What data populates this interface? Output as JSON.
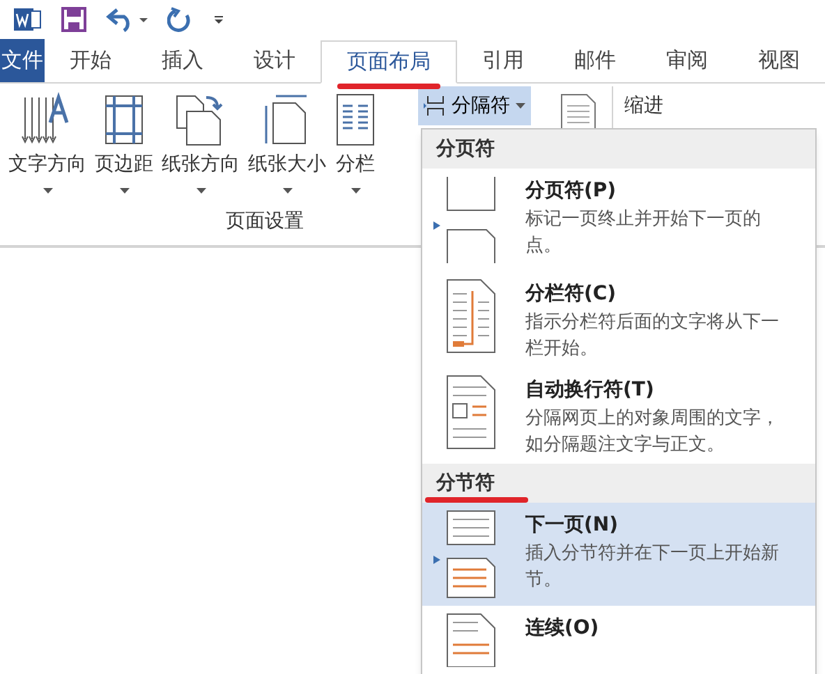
{
  "tabs": [
    {
      "label": "文件",
      "kind": "file",
      "selected": false
    },
    {
      "label": "开始",
      "kind": "tab",
      "selected": false
    },
    {
      "label": "插入",
      "kind": "tab",
      "selected": false
    },
    {
      "label": "设计",
      "kind": "tab",
      "selected": false
    },
    {
      "label": "页面布局",
      "kind": "tab",
      "selected": true
    },
    {
      "label": "引用",
      "kind": "tab",
      "selected": false
    },
    {
      "label": "邮件",
      "kind": "tab",
      "selected": false
    },
    {
      "label": "审阅",
      "kind": "tab",
      "selected": false
    },
    {
      "label": "视图",
      "kind": "tab",
      "selected": false
    }
  ],
  "ribbon": {
    "group_label": "页面设置",
    "buttons": [
      {
        "label": "文字方向",
        "kind": "text-direction"
      },
      {
        "label": "页边距",
        "kind": "margins"
      },
      {
        "label": "纸张方向",
        "kind": "orientation"
      },
      {
        "label": "纸张大小",
        "kind": "size"
      },
      {
        "label": "分栏",
        "kind": "columns"
      }
    ],
    "breaks_button": {
      "label": "分隔符",
      "open": true
    },
    "indent_label": "缩进"
  },
  "menu": {
    "sections": [
      {
        "header": "分页符",
        "items": [
          {
            "title": "分页符(P)",
            "description": "标记一页终止并开始下一页的点。",
            "kind": "page",
            "selected": false
          },
          {
            "title": "分栏符(C)",
            "description": "指示分栏符后面的文字将从下一栏开始。",
            "kind": "column",
            "selected": false
          },
          {
            "title": "自动换行符(T)",
            "description": "分隔网页上的对象周围的文字，如分隔题注文字与正文。",
            "kind": "wrap",
            "selected": false
          }
        ]
      },
      {
        "header": "分节符",
        "items": [
          {
            "title": "下一页(N)",
            "description": "插入分节符并在下一页上开始新节。",
            "kind": "next",
            "selected": true
          },
          {
            "title": "连续(O)",
            "kind": "continuous",
            "selected": false
          }
        ]
      }
    ]
  }
}
